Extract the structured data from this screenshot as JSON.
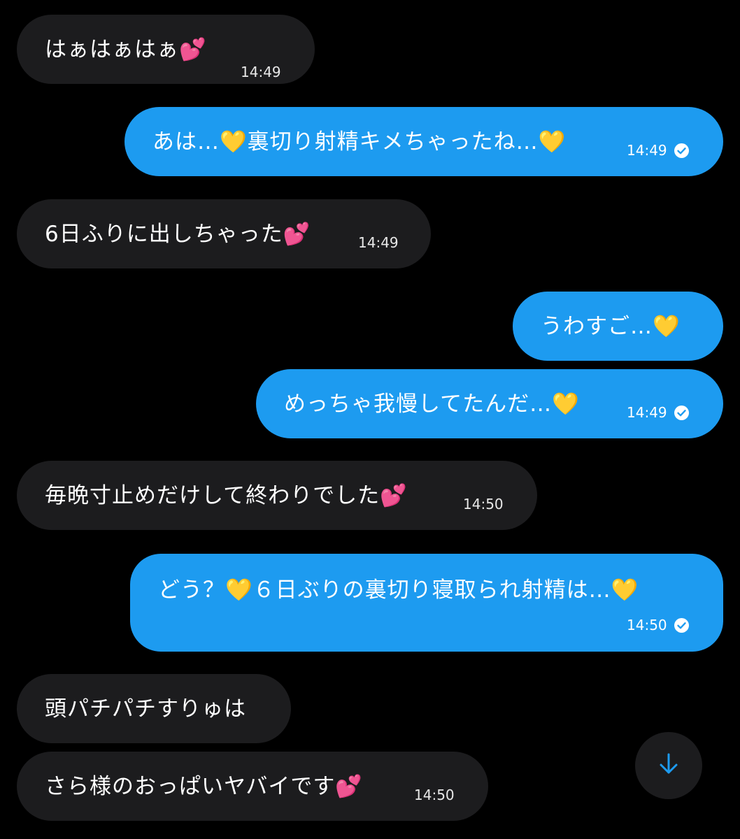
{
  "colors": {
    "background": "#000000",
    "incoming_bubble": "#1c1c1e",
    "outgoing_bubble": "#1d9bf0",
    "text": "#ffffff",
    "scroll_arrow": "#1d9bf0"
  },
  "messages": [
    {
      "direction": "incoming",
      "text": "はぁはぁはぁ💕",
      "time": "14:49"
    },
    {
      "direction": "outgoing",
      "text": "あは…💛裏切り射精キメちゃったね…💛",
      "time": "14:49",
      "status_icon": "read-check-icon"
    },
    {
      "direction": "incoming",
      "text": "6日ふりに出しちゃった💕",
      "time": "14:49"
    },
    {
      "direction": "outgoing",
      "text": "うわすご…💛"
    },
    {
      "direction": "outgoing",
      "text": "めっちゃ我慢してたんだ…💛",
      "time": "14:49",
      "status_icon": "read-check-icon"
    },
    {
      "direction": "incoming",
      "text": "毎晩寸止めだけして終わりでした💕",
      "time": "14:50"
    },
    {
      "direction": "outgoing",
      "text": "どう？💛６日ぶりの裏切り寝取られ射精は…💛",
      "time": "14:50",
      "status_icon": "read-check-icon"
    },
    {
      "direction": "incoming",
      "text": "頭パチパチすりゅは"
    },
    {
      "direction": "incoming",
      "text": "さら様のおっぱいヤバイです💕",
      "time": "14:50"
    }
  ],
  "scroll_button": {
    "icon": "arrow-down-icon"
  }
}
